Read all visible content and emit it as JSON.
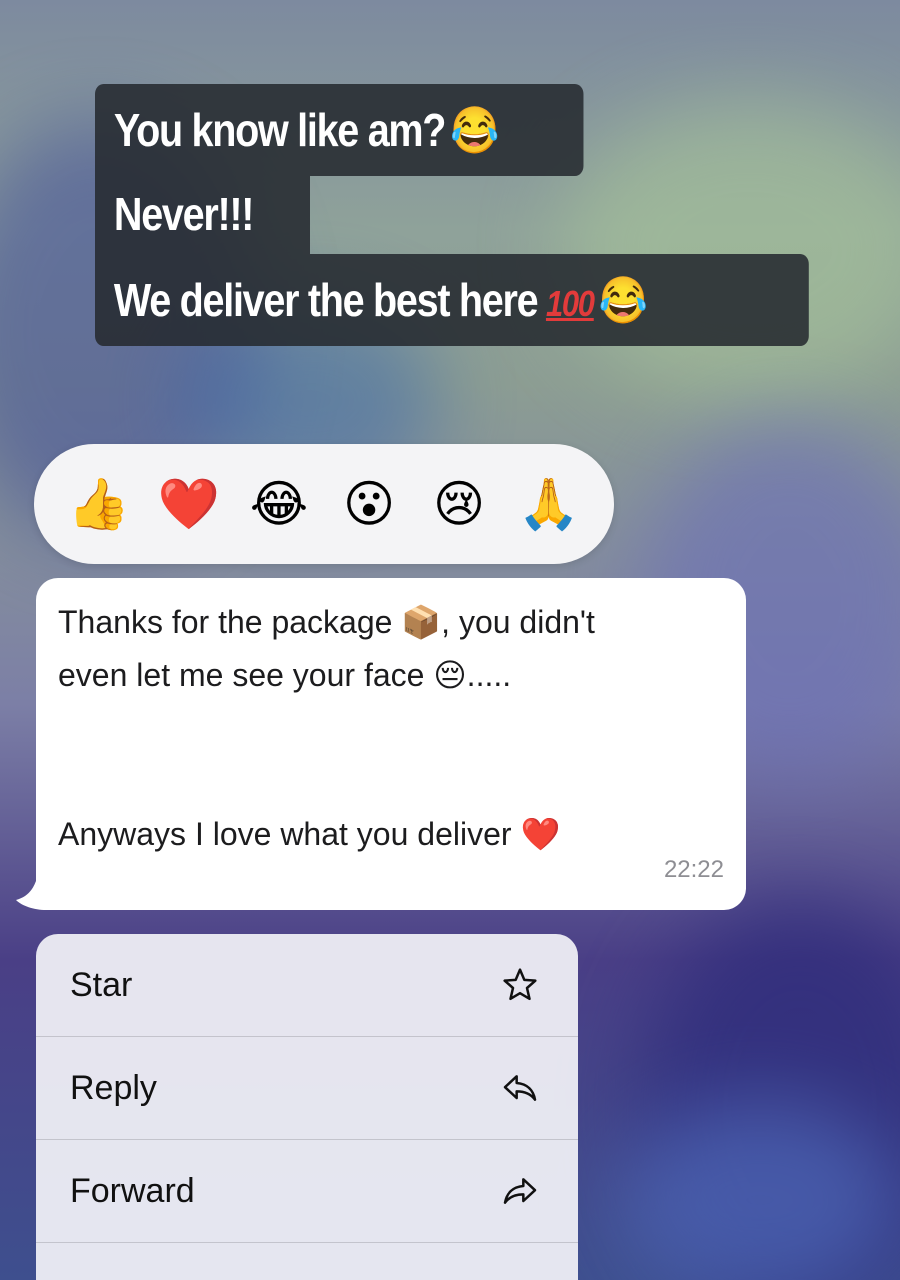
{
  "story_caption": {
    "line1": "You know like am?",
    "line2": "Never!!!",
    "line3": "We deliver the best here",
    "line3_badge": "100"
  },
  "reactions": [
    {
      "icon": "thumbs-up-icon",
      "glyph": "👍"
    },
    {
      "icon": "red-heart-icon",
      "glyph": "❤️"
    },
    {
      "icon": "tears-of-joy-icon",
      "glyph": "😂"
    },
    {
      "icon": "surprised-face-icon",
      "glyph": "😮"
    },
    {
      "icon": "crying-face-icon",
      "glyph": "😢"
    },
    {
      "icon": "folded-hands-icon",
      "glyph": "🙏"
    }
  ],
  "message": {
    "line1_a": "Thanks for the package ",
    "line1_b": ", you didn't",
    "line2_a": "even let me see your face ",
    "line2_b": ".....",
    "line3": "Anyways I love what you deliver ",
    "time": "22:22"
  },
  "menu": {
    "items": [
      {
        "label": "Star",
        "icon": "star-icon"
      },
      {
        "label": "Reply",
        "icon": "reply-icon"
      },
      {
        "label": "Forward",
        "icon": "forward-icon"
      }
    ]
  },
  "colors": {
    "caption_bg": "#262a30",
    "bubble_bg": "#ffffff",
    "menu_bg": "#ececf4",
    "timestamp": "#8e8e93",
    "accent_red": "#e23b3b"
  }
}
